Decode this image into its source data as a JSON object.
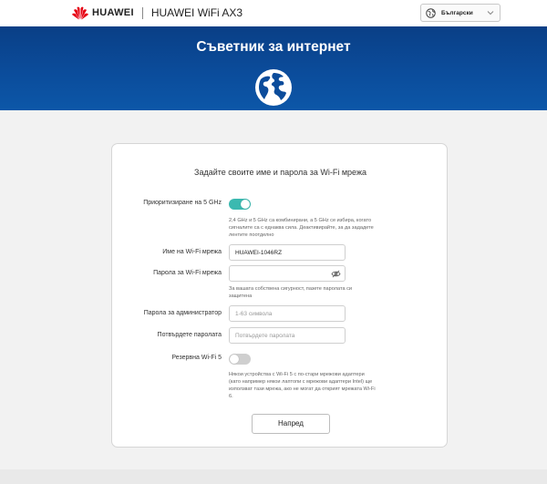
{
  "header": {
    "brand": "HUAWEI",
    "product": "HUAWEI WiFi AX3",
    "language": {
      "selected": "Български",
      "icon": "globe-icon"
    }
  },
  "banner": {
    "title": "Съветник за интернет",
    "icon": "globe-icon"
  },
  "form": {
    "title": "Задайте своите име и парола за Wi-Fi мрежа",
    "prioritize_5ghz": {
      "label": "Приоритизиране на 5 GHz",
      "enabled": true,
      "note_line1": "2,4 GHz и 5 GHz са комбинирани, а 5 GHz се избира, когато",
      "note_line2": "сигналите са с еднаква сила. Деактивирайте, за да зададете",
      "note_line3": "лентите поотделно"
    },
    "wifi_name": {
      "label": "Име на Wi-Fi мрежа",
      "value": "HUAWEI-1046RZ"
    },
    "wifi_password": {
      "label": "Парола за Wi-Fi мрежа",
      "value": "",
      "icon": "eye-icon",
      "note_line1": "За вашата собствена сигурност, пазете паролата си",
      "note_line2": "защитена"
    },
    "admin_password": {
      "label": "Парола за администратор",
      "placeholder": "1-63 символа"
    },
    "confirm_password": {
      "label": "Потвърдете паролата",
      "placeholder": "Потвърдете паролата"
    },
    "backup_wifi5": {
      "label": "Резервна Wi-Fi 5",
      "enabled": false,
      "note_line1": "Някои устройства с Wi-Fi 5 с по-стари мрежови адаптери",
      "note_line2": "(като например някои лаптопи с мрежови адаптери Intel) ще",
      "note_line3": "използват тази мрежа, ако не могат да открият мрежата Wi-Fi",
      "note_line4": "6."
    },
    "next_button": "Напред"
  },
  "colors": {
    "accent": "#3bb9b0",
    "banner": "#0b4c9b"
  }
}
